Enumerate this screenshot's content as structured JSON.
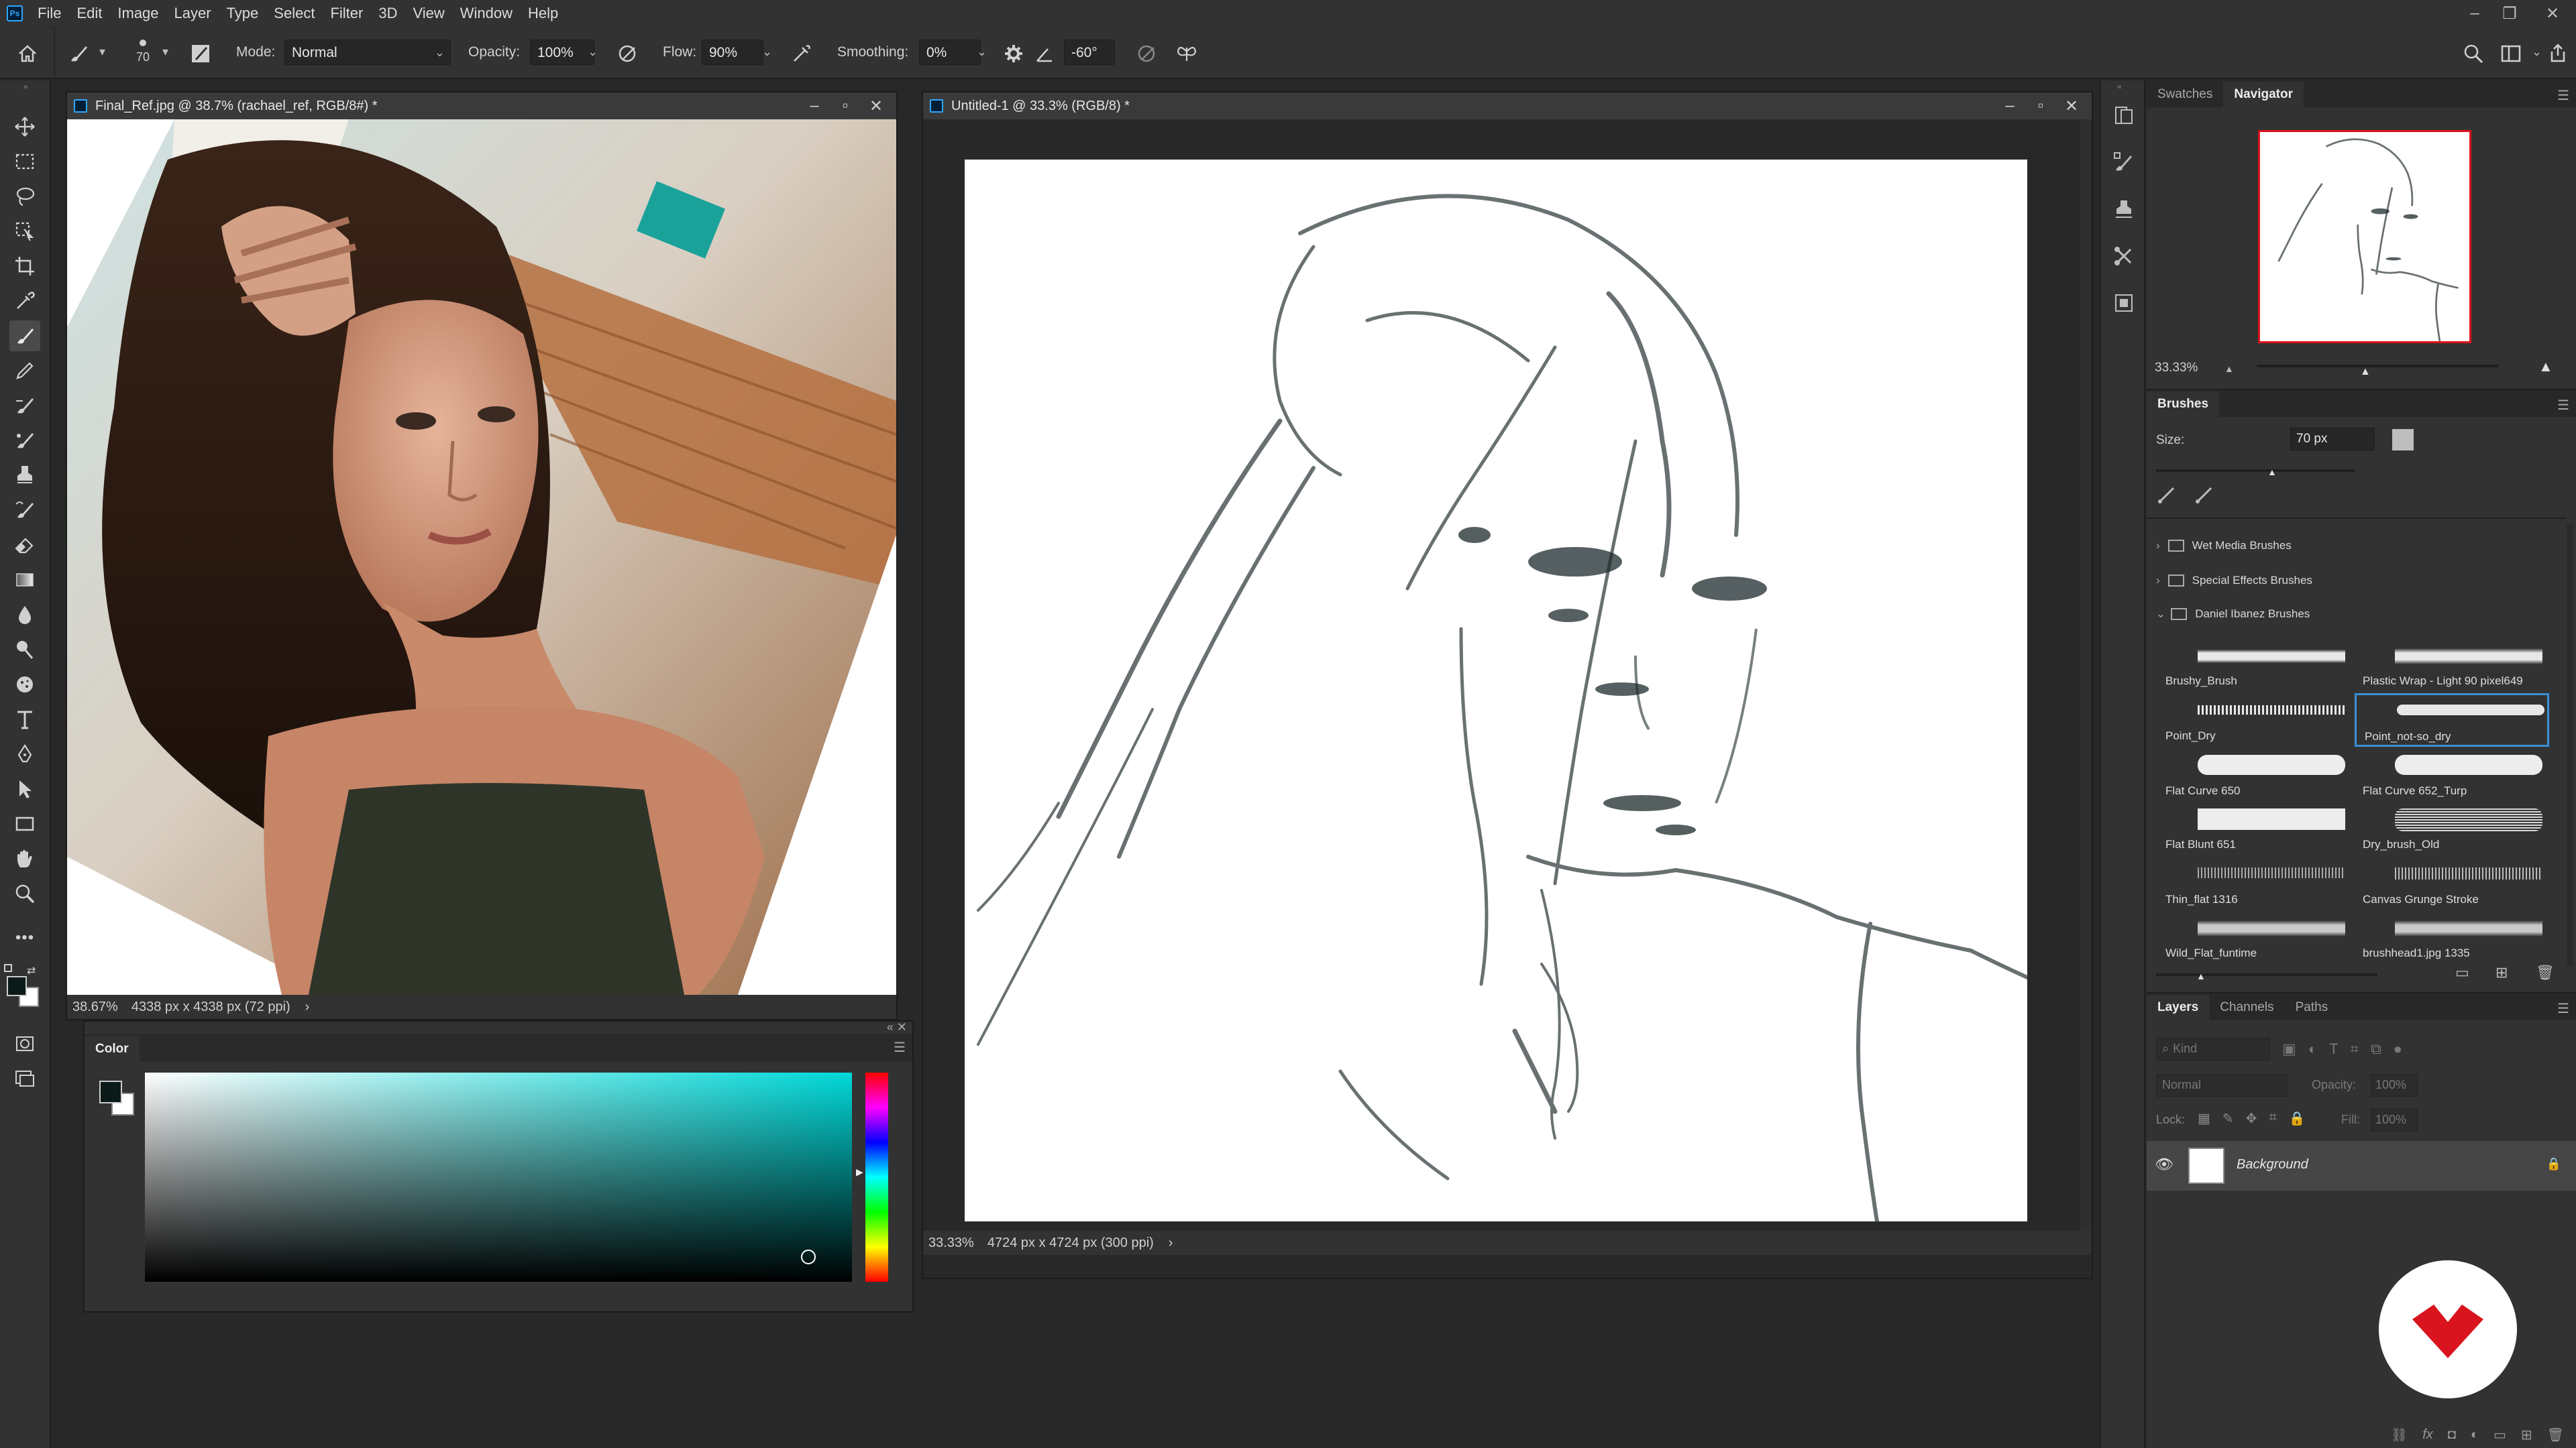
{
  "menubar": {
    "items": [
      "File",
      "Edit",
      "Image",
      "Layer",
      "Type",
      "Select",
      "Filter",
      "3D",
      "View",
      "Window",
      "Help"
    ]
  },
  "options": {
    "brush_size": "70",
    "mode_label": "Mode:",
    "mode_value": "Normal",
    "opacity_label": "Opacity:",
    "opacity_value": "100%",
    "flow_label": "Flow:",
    "flow_value": "90%",
    "smoothing_label": "Smoothing:",
    "smoothing_value": "0%",
    "angle_value": "-60°"
  },
  "doc_ref": {
    "title": "Final_Ref.jpg @ 38.7% (rachael_ref, RGB/8#) *",
    "zoom": "38.67%",
    "info": "4338 px x 4338 px (72 ppi)",
    "info_arrow": "›"
  },
  "doc_main": {
    "title": "Untitled-1 @ 33.3% (RGB/8) *",
    "zoom": "33.33%",
    "info": "4724 px x 4724 px (300 ppi)",
    "info_arrow": "›"
  },
  "color_panel": {
    "tab": "Color",
    "accent": "#00d8d8"
  },
  "navigator": {
    "tabs": [
      "Swatches",
      "Navigator"
    ],
    "active": "Navigator",
    "zoom": "33.33%"
  },
  "brushes": {
    "tab": "Brushes",
    "size_label": "Size:",
    "size_value": "70 px",
    "folders": [
      "Wet Media Brushes",
      "Special Effects Brushes",
      "Daniel Ibanez Brushes"
    ],
    "items": [
      "Brushy_Brush",
      "Plastic Wrap - Light 90 pixel649",
      "Point_Dry",
      "Point_not-so_dry",
      "Flat Curve 650",
      "Flat Curve 652_Turp",
      "Flat Blunt 651",
      "Dry_brush_Old",
      "Thin_flat 1316",
      "Canvas Grunge Stroke",
      "Wild_Flat_funtime",
      "brushhead1.jpg 1335"
    ],
    "selected": "Point_not-so_dry"
  },
  "layers": {
    "tabs": [
      "Layers",
      "Channels",
      "Paths"
    ],
    "active": "Layers",
    "kind_placeholder": "Kind",
    "blend_mode": "Normal",
    "opacity_label": "Opacity:",
    "opacity_value": "100%",
    "lock_label": "Lock:",
    "fill_label": "Fill:",
    "fill_value": "100%",
    "layer_name": "Background"
  },
  "colors": {
    "selection_blue": "#3a8fd6",
    "watermark_red": "#d9141e"
  }
}
